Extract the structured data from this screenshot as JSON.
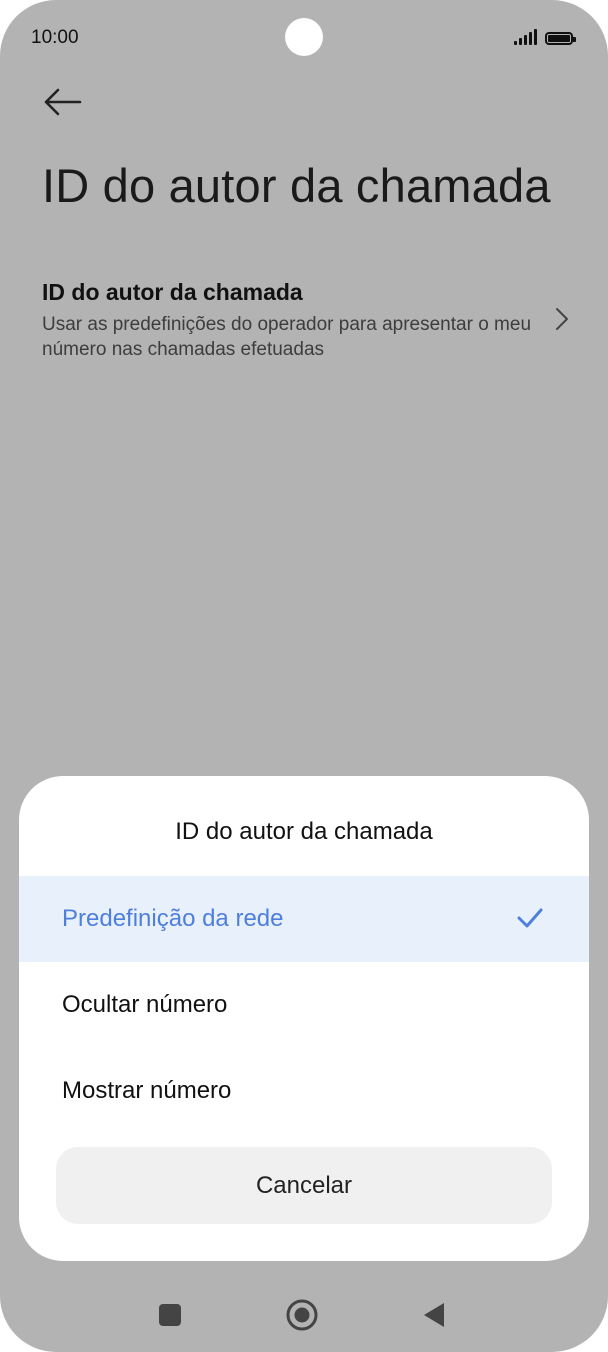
{
  "status_bar": {
    "time": "10:00",
    "signal_icon": "signal-icon",
    "battery_icon": "battery-icon"
  },
  "header": {
    "back_icon": "arrow-left-icon",
    "title": "ID do autor da chamada"
  },
  "setting": {
    "title": "ID do autor da chamada",
    "description": "Usar as predefinições do operador para apresentar o meu número nas chamadas efetuadas",
    "chevron_icon": "chevron-right-icon"
  },
  "sheet": {
    "title": "ID do autor da chamada",
    "options": [
      {
        "label": "Predefinição da rede",
        "selected": true
      },
      {
        "label": "Ocultar número",
        "selected": false
      },
      {
        "label": "Mostrar número",
        "selected": false
      }
    ],
    "cancel_label": "Cancelar",
    "selected_check_icon": "check-icon"
  },
  "nav_bar": {
    "recents_icon": "square-icon",
    "home_icon": "circle-home-icon",
    "back_icon": "triangle-back-icon"
  },
  "colors": {
    "scrim": "#b3b3b3",
    "accent": "#4f7fdc",
    "selected_bg": "#e8f0fc"
  }
}
